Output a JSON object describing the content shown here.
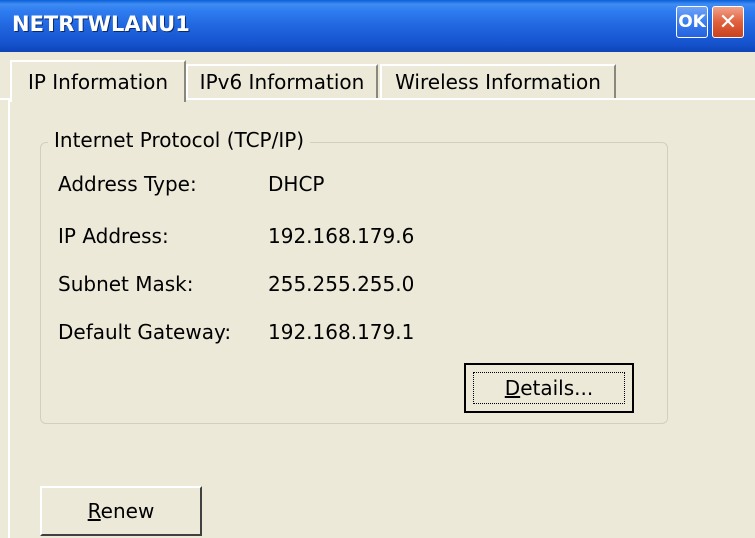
{
  "window": {
    "title": "NETRTWLANU1",
    "ok_label": "OK",
    "close_glyph": "✕"
  },
  "tabs": [
    {
      "label": "IP Information",
      "active": true
    },
    {
      "label": "IPv6 Information",
      "active": false
    },
    {
      "label": "Wireless Information",
      "active": false
    }
  ],
  "group": {
    "title": "Internet Protocol (TCP/IP)",
    "fields": [
      {
        "label": "Address Type:",
        "value": "DHCP"
      },
      {
        "label": "IP Address:",
        "value": "192.168.179.6"
      },
      {
        "label": "Subnet Mask:",
        "value": "255.255.255.0"
      },
      {
        "label": "Default Gateway:",
        "value": "192.168.179.1"
      }
    ]
  },
  "buttons": {
    "details": {
      "mnemonic": "D",
      "rest": "etails..."
    },
    "renew": {
      "mnemonic": "R",
      "rest": "enew"
    }
  }
}
